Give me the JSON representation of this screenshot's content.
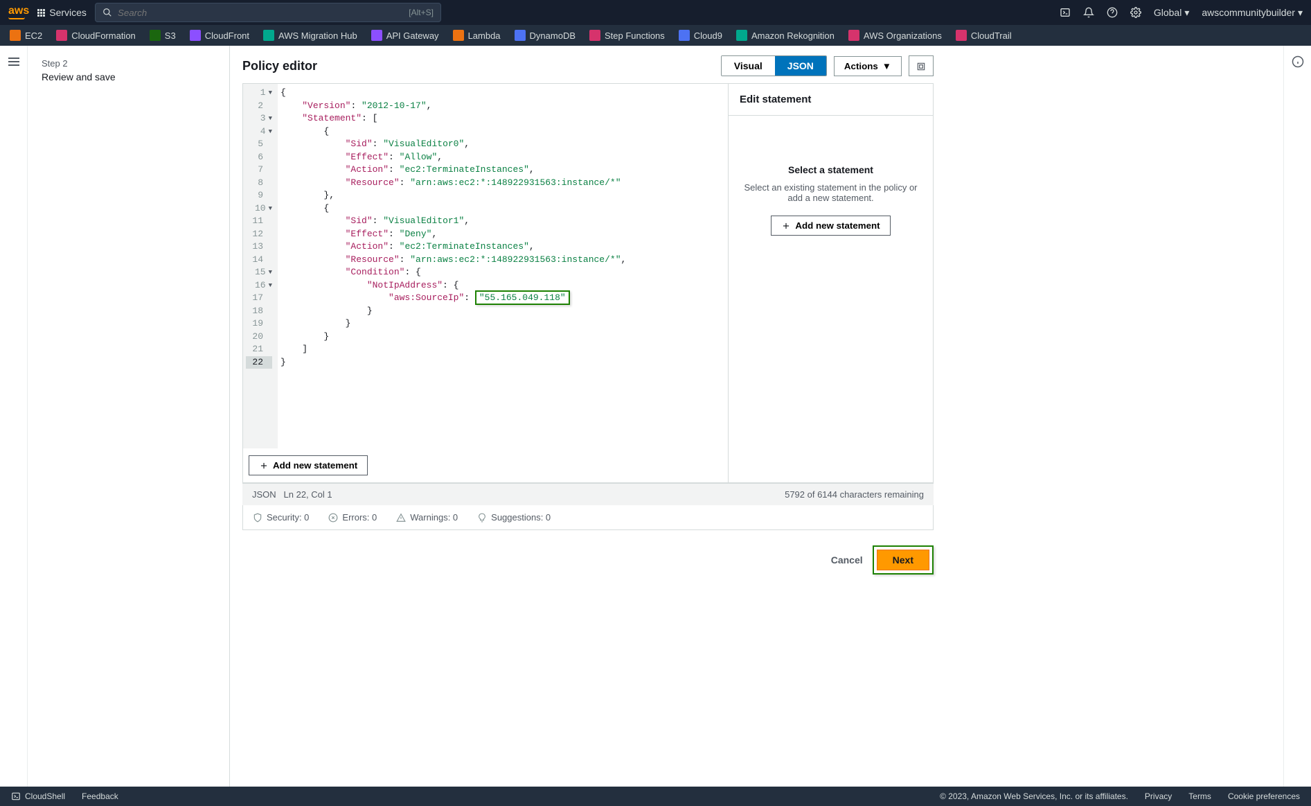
{
  "header": {
    "services_label": "Services",
    "search_placeholder": "Search",
    "search_shortcut": "[Alt+S]",
    "region": "Global",
    "user": "awscommunitybuilder"
  },
  "service_bar": [
    {
      "label": "EC2",
      "color": "#ec7211"
    },
    {
      "label": "CloudFormation",
      "color": "#d6336c"
    },
    {
      "label": "S3",
      "color": "#1b660f"
    },
    {
      "label": "CloudFront",
      "color": "#8c4fff"
    },
    {
      "label": "AWS Migration Hub",
      "color": "#01a88d"
    },
    {
      "label": "API Gateway",
      "color": "#8c4fff"
    },
    {
      "label": "Lambda",
      "color": "#ec7211"
    },
    {
      "label": "DynamoDB",
      "color": "#4d72f3"
    },
    {
      "label": "Step Functions",
      "color": "#d6336c"
    },
    {
      "label": "Cloud9",
      "color": "#4d72f3"
    },
    {
      "label": "Amazon Rekognition",
      "color": "#01a88d"
    },
    {
      "label": "AWS Organizations",
      "color": "#d6336c"
    },
    {
      "label": "CloudTrail",
      "color": "#d6336c"
    }
  ],
  "step": {
    "label": "Step 2",
    "title": "Review and save"
  },
  "editor": {
    "title": "Policy editor",
    "toggle": {
      "visual": "Visual",
      "json": "JSON"
    },
    "actions_label": "Actions",
    "add_statement_label": "Add new statement",
    "status_mode": "JSON",
    "status_pos": "Ln 22, Col 1",
    "chars_remaining": "5792 of 6144 characters remaining",
    "security": "Security: 0",
    "errors": "Errors: 0",
    "warnings": "Warnings: 0",
    "suggestions": "Suggestions: 0"
  },
  "side_panel": {
    "header": "Edit statement",
    "title": "Select a statement",
    "desc": "Select an existing statement in the policy or add a new statement.",
    "add_btn": "Add new statement"
  },
  "code": {
    "lines": [
      {
        "n": 1,
        "fold": true,
        "indent": 0,
        "segments": [
          {
            "t": "{",
            "c": "punc"
          }
        ]
      },
      {
        "n": 2,
        "indent": 1,
        "segments": [
          {
            "t": "\"Version\"",
            "c": "key"
          },
          {
            "t": ": ",
            "c": "punc"
          },
          {
            "t": "\"2012-10-17\"",
            "c": "str"
          },
          {
            "t": ",",
            "c": "punc"
          }
        ]
      },
      {
        "n": 3,
        "fold": true,
        "indent": 1,
        "segments": [
          {
            "t": "\"Statement\"",
            "c": "key"
          },
          {
            "t": ": [",
            "c": "punc"
          }
        ]
      },
      {
        "n": 4,
        "fold": true,
        "indent": 2,
        "segments": [
          {
            "t": "{",
            "c": "punc"
          }
        ]
      },
      {
        "n": 5,
        "indent": 3,
        "segments": [
          {
            "t": "\"Sid\"",
            "c": "key"
          },
          {
            "t": ": ",
            "c": "punc"
          },
          {
            "t": "\"VisualEditor0\"",
            "c": "str"
          },
          {
            "t": ",",
            "c": "punc"
          }
        ]
      },
      {
        "n": 6,
        "indent": 3,
        "segments": [
          {
            "t": "\"Effect\"",
            "c": "key"
          },
          {
            "t": ": ",
            "c": "punc"
          },
          {
            "t": "\"Allow\"",
            "c": "str"
          },
          {
            "t": ",",
            "c": "punc"
          }
        ]
      },
      {
        "n": 7,
        "indent": 3,
        "segments": [
          {
            "t": "\"Action\"",
            "c": "key"
          },
          {
            "t": ": ",
            "c": "punc"
          },
          {
            "t": "\"ec2:TerminateInstances\"",
            "c": "str"
          },
          {
            "t": ",",
            "c": "punc"
          }
        ]
      },
      {
        "n": 8,
        "indent": 3,
        "segments": [
          {
            "t": "\"Resource\"",
            "c": "key"
          },
          {
            "t": ": ",
            "c": "punc"
          },
          {
            "t": "\"arn:aws:ec2:*:148922931563:instance/*\"",
            "c": "str"
          }
        ]
      },
      {
        "n": 9,
        "indent": 2,
        "segments": [
          {
            "t": "},",
            "c": "punc"
          }
        ]
      },
      {
        "n": 10,
        "fold": true,
        "indent": 2,
        "segments": [
          {
            "t": "{",
            "c": "punc"
          }
        ]
      },
      {
        "n": 11,
        "indent": 3,
        "segments": [
          {
            "t": "\"Sid\"",
            "c": "key"
          },
          {
            "t": ": ",
            "c": "punc"
          },
          {
            "t": "\"VisualEditor1\"",
            "c": "str"
          },
          {
            "t": ",",
            "c": "punc"
          }
        ]
      },
      {
        "n": 12,
        "indent": 3,
        "segments": [
          {
            "t": "\"Effect\"",
            "c": "key"
          },
          {
            "t": ": ",
            "c": "punc"
          },
          {
            "t": "\"Deny\"",
            "c": "str"
          },
          {
            "t": ",",
            "c": "punc"
          }
        ]
      },
      {
        "n": 13,
        "indent": 3,
        "segments": [
          {
            "t": "\"Action\"",
            "c": "key"
          },
          {
            "t": ": ",
            "c": "punc"
          },
          {
            "t": "\"ec2:TerminateInstances\"",
            "c": "str"
          },
          {
            "t": ",",
            "c": "punc"
          }
        ]
      },
      {
        "n": 14,
        "indent": 3,
        "segments": [
          {
            "t": "\"Resource\"",
            "c": "key"
          },
          {
            "t": ": ",
            "c": "punc"
          },
          {
            "t": "\"arn:aws:ec2:*:148922931563:instance/*\"",
            "c": "str"
          },
          {
            "t": ",",
            "c": "punc"
          }
        ]
      },
      {
        "n": 15,
        "fold": true,
        "indent": 3,
        "segments": [
          {
            "t": "\"Condition\"",
            "c": "key"
          },
          {
            "t": ": {",
            "c": "punc"
          }
        ]
      },
      {
        "n": 16,
        "fold": true,
        "indent": 4,
        "segments": [
          {
            "t": "\"NotIpAddress\"",
            "c": "key"
          },
          {
            "t": ": {",
            "c": "punc"
          }
        ]
      },
      {
        "n": 17,
        "indent": 5,
        "segments": [
          {
            "t": "\"aws:SourceIp\"",
            "c": "key"
          },
          {
            "t": ": ",
            "c": "punc"
          },
          {
            "t": "\"55.165.049.118\"",
            "c": "str",
            "hl": true
          }
        ]
      },
      {
        "n": 18,
        "indent": 4,
        "segments": [
          {
            "t": "}",
            "c": "punc"
          }
        ]
      },
      {
        "n": 19,
        "indent": 3,
        "segments": [
          {
            "t": "}",
            "c": "punc"
          }
        ]
      },
      {
        "n": 20,
        "indent": 2,
        "segments": [
          {
            "t": "}",
            "c": "punc"
          }
        ]
      },
      {
        "n": 21,
        "indent": 1,
        "segments": [
          {
            "t": "]",
            "c": "punc"
          }
        ]
      },
      {
        "n": 22,
        "active": true,
        "indent": 0,
        "segments": [
          {
            "t": "}",
            "c": "punc"
          }
        ]
      }
    ]
  },
  "actions": {
    "cancel": "Cancel",
    "next": "Next"
  },
  "footer": {
    "cloudshell": "CloudShell",
    "feedback": "Feedback",
    "copyright": "© 2023, Amazon Web Services, Inc. or its affiliates.",
    "privacy": "Privacy",
    "terms": "Terms",
    "cookies": "Cookie preferences"
  }
}
